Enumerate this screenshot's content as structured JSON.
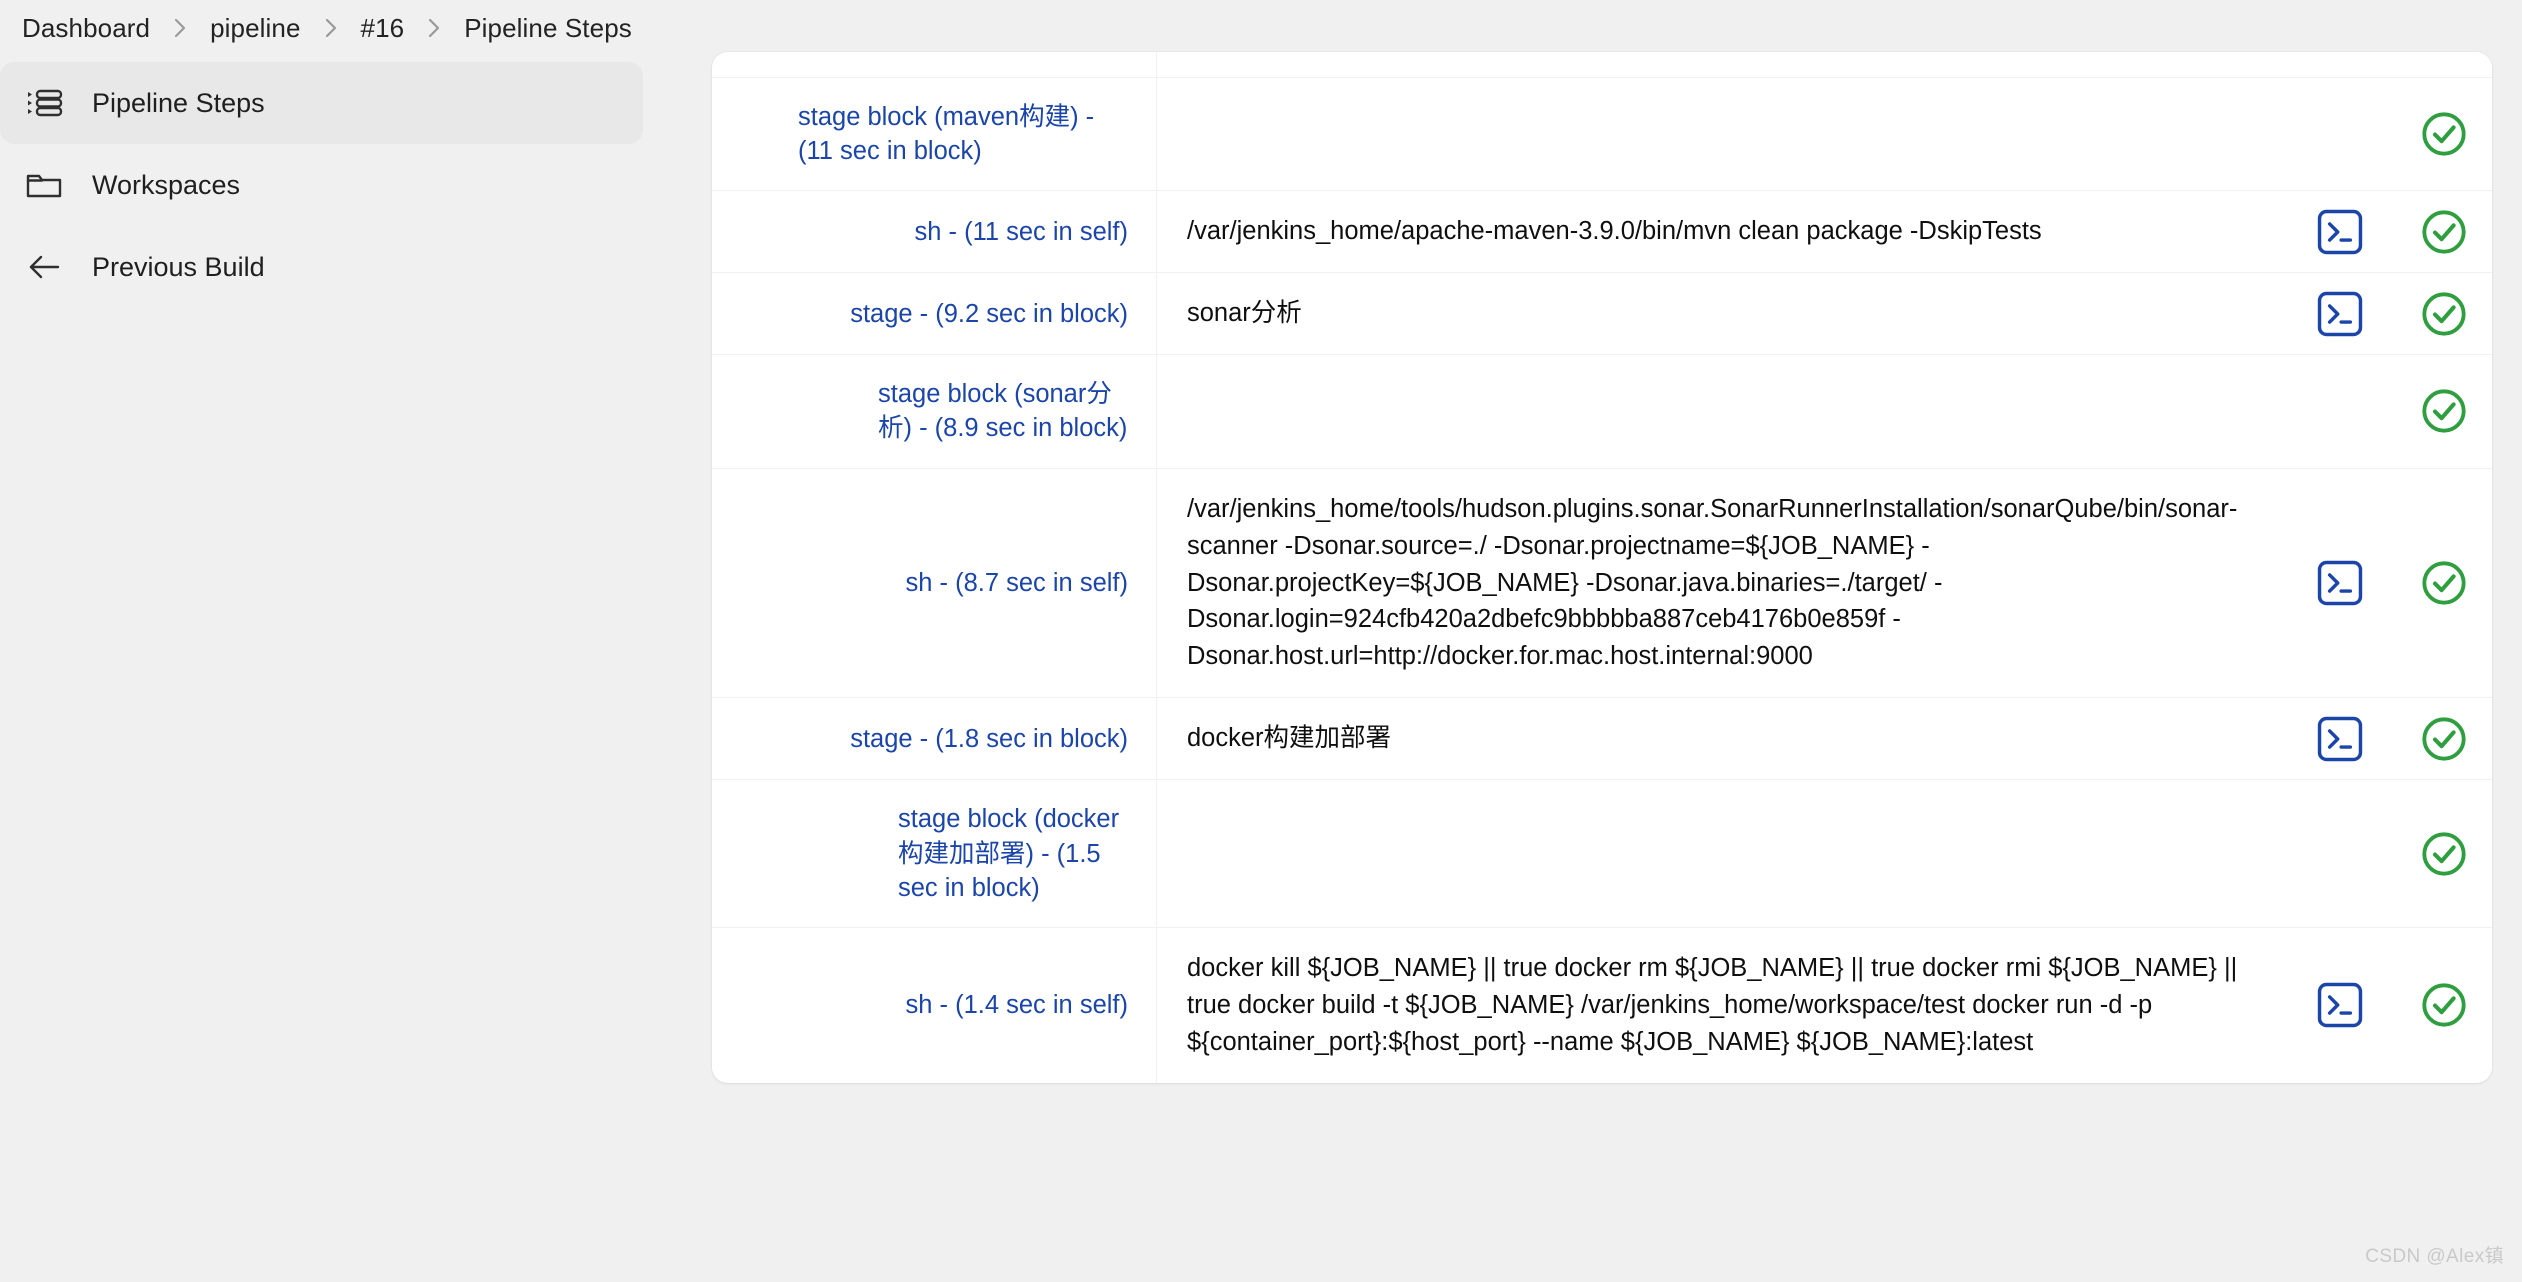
{
  "breadcrumb": {
    "items": [
      {
        "label": "Dashboard"
      },
      {
        "label": "pipeline"
      },
      {
        "label": "#16"
      },
      {
        "label": "Pipeline Steps"
      }
    ],
    "separator_icon": "chevron-right-icon"
  },
  "sidebar": {
    "items": [
      {
        "label": "Pipeline Steps",
        "icon": "pipeline-steps-icon",
        "active": true
      },
      {
        "label": "Workspaces",
        "icon": "folder-icon",
        "active": false
      },
      {
        "label": "Previous Build",
        "icon": "arrow-left-icon",
        "active": false
      }
    ]
  },
  "steps_table": {
    "console_icon": "console-terminal-icon",
    "status_icon": "success-check-icon",
    "rows": [
      {
        "label": "",
        "arguments": "",
        "has_console": false,
        "has_status": false,
        "partial": true
      },
      {
        "label": "stage block (maven构建) - (11 sec in block)",
        "arguments": "",
        "has_console": false,
        "has_status": true
      },
      {
        "label": "sh - (11 sec in self)",
        "arguments": "/var/jenkins_home/apache-maven-3.9.0/bin/mvn clean package -DskipTests",
        "has_console": true,
        "has_status": true
      },
      {
        "label": "stage - (9.2 sec in block)",
        "arguments": "sonar分析",
        "has_console": true,
        "has_status": true
      },
      {
        "label": "stage block (sonar分析) - (8.9 sec in block)",
        "arguments": "",
        "has_console": false,
        "has_status": true
      },
      {
        "label": "sh - (8.7 sec in self)",
        "arguments": "/var/jenkins_home/tools/hudson.plugins.sonar.SonarRunnerInstallation/sonarQube/bin/sonar-scanner -Dsonar.source=./ -Dsonar.projectname=${JOB_NAME} -Dsonar.projectKey=${JOB_NAME} -Dsonar.java.binaries=./target/ -Dsonar.login=924cfb420a2dbefc9bbbbba887ceb4176b0e859f -Dsonar.host.url=http://docker.for.mac.host.internal:9000",
        "has_console": true,
        "has_status": true
      },
      {
        "label": "stage - (1.8 sec in block)",
        "arguments": "docker构建加部署",
        "has_console": true,
        "has_status": true
      },
      {
        "label": "stage block (docker构建加部署) - (1.5 sec in block)",
        "arguments": "",
        "has_console": false,
        "has_status": true
      },
      {
        "label": "sh - (1.4 sec in self)",
        "arguments": "docker kill ${JOB_NAME} || true docker rm ${JOB_NAME} || true docker rmi ${JOB_NAME} || true docker build -t ${JOB_NAME} /var/jenkins_home/workspace/test docker run -d -p ${container_port}:${host_port} --name ${JOB_NAME} ${JOB_NAME}:latest",
        "has_console": true,
        "has_status": true
      }
    ]
  },
  "watermark": {
    "text": "CSDN @Alex镇"
  },
  "colors": {
    "link": "#1b45a8",
    "success": "#2e9e3e",
    "console": "#1b45a8",
    "page_bg": "#f0f0f0",
    "card_bg": "#ffffff",
    "active_item_bg": "#e8e8e8"
  }
}
